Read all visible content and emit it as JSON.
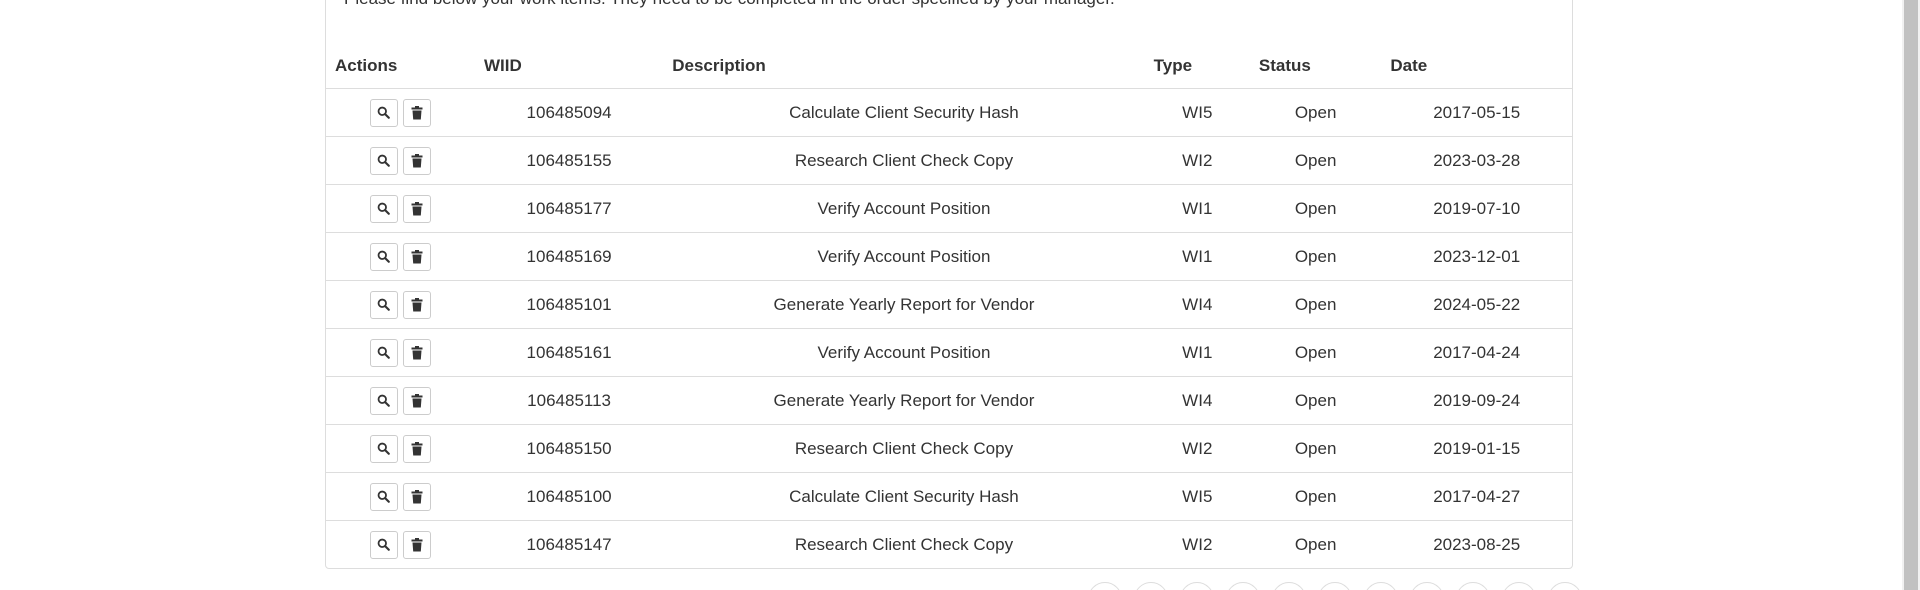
{
  "intro_text": "Please find below your work items. They need to be completed in the order specified by your manager.",
  "table": {
    "headers": {
      "actions": "Actions",
      "wiid": "WIID",
      "description": "Description",
      "type": "Type",
      "status": "Status",
      "date": "Date"
    },
    "rows": [
      {
        "wiid": "106485094",
        "description": "Calculate Client Security Hash",
        "type": "WI5",
        "status": "Open",
        "date": "2017-05-15"
      },
      {
        "wiid": "106485155",
        "description": "Research Client Check Copy",
        "type": "WI2",
        "status": "Open",
        "date": "2023-03-28"
      },
      {
        "wiid": "106485177",
        "description": "Verify Account Position",
        "type": "WI1",
        "status": "Open",
        "date": "2019-07-10"
      },
      {
        "wiid": "106485169",
        "description": "Verify Account Position",
        "type": "WI1",
        "status": "Open",
        "date": "2023-12-01"
      },
      {
        "wiid": "106485101",
        "description": "Generate Yearly Report for Vendor",
        "type": "WI4",
        "status": "Open",
        "date": "2024-05-22"
      },
      {
        "wiid": "106485161",
        "description": "Verify Account Position",
        "type": "WI1",
        "status": "Open",
        "date": "2017-04-24"
      },
      {
        "wiid": "106485113",
        "description": "Generate Yearly Report for Vendor",
        "type": "WI4",
        "status": "Open",
        "date": "2019-09-24"
      },
      {
        "wiid": "106485150",
        "description": "Research Client Check Copy",
        "type": "WI2",
        "status": "Open",
        "date": "2019-01-15"
      },
      {
        "wiid": "106485100",
        "description": "Calculate Client Security Hash",
        "type": "WI5",
        "status": "Open",
        "date": "2017-04-27"
      },
      {
        "wiid": "106485147",
        "description": "Research Client Check Copy",
        "type": "WI2",
        "status": "Open",
        "date": "2023-08-25"
      }
    ]
  },
  "icons": {
    "view": "search-icon",
    "delete": "trash-icon"
  },
  "colors": {
    "text": "#333333",
    "border": "#dddddd",
    "scrollbar_thumb": "#c1c1c1"
  }
}
